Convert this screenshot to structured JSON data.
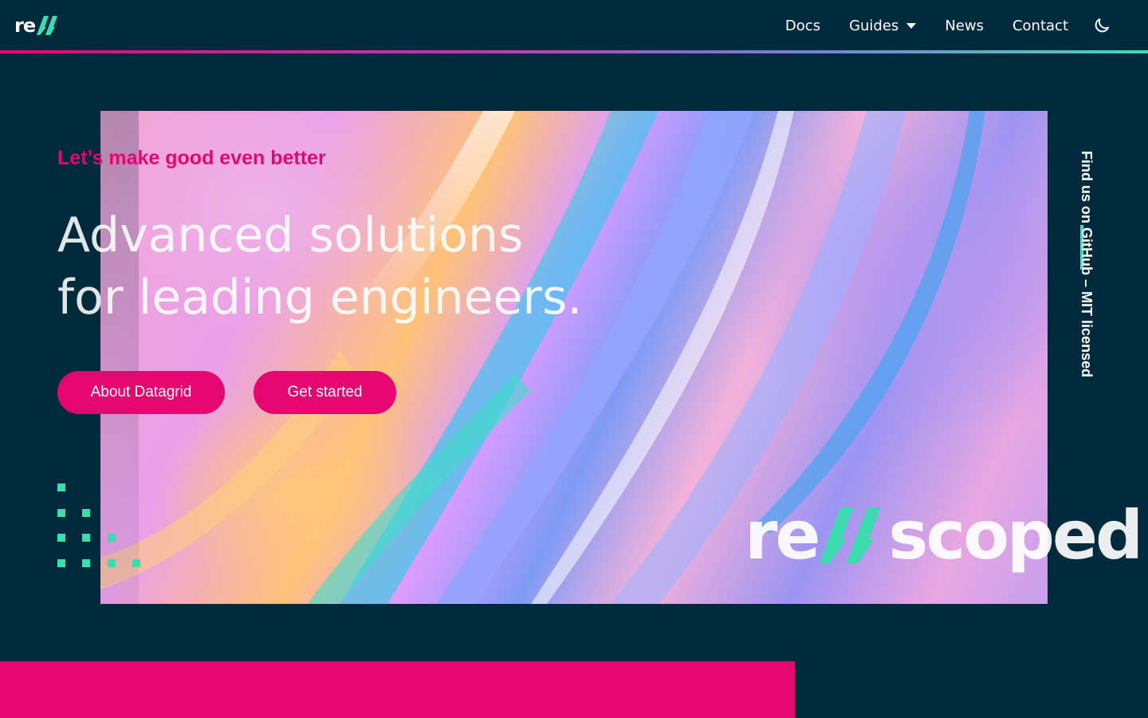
{
  "nav": {
    "logo": "re",
    "links": [
      "Docs",
      "Guides",
      "News",
      "Contact"
    ],
    "theme_toggle_icon": "moon-icon"
  },
  "hero": {
    "tagline": "Let’s make good even better",
    "headline_line1": "Advanced solutions",
    "headline_line2": "for leading engineers.",
    "buttons": {
      "about": "About Datagrid",
      "start": "Get started"
    }
  },
  "side": {
    "github_text": "Find us on GitHub – MIT licensed"
  },
  "wordmark": {
    "prefix": "re",
    "suffix": "scoped"
  },
  "colors": {
    "background": "#012a3c",
    "accent_pink": "#e5066f",
    "accent_green": "#3ddcb0"
  }
}
